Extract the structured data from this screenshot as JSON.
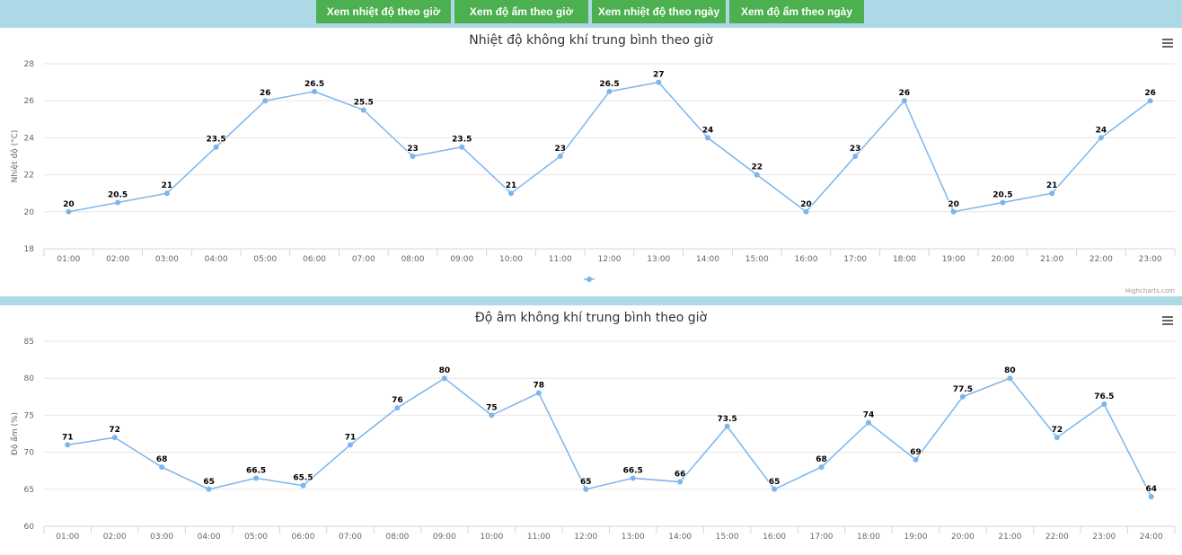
{
  "tabs": [
    {
      "label": "Xem nhiệt độ theo giờ"
    },
    {
      "label": "Xem độ ẩm theo giờ"
    },
    {
      "label": "Xem nhiệt độ theo ngày"
    },
    {
      "label": "Xem độ ẩm theo ngày"
    }
  ],
  "colors": {
    "accent": "#4caf50",
    "line": "#7cb5ec",
    "background": "#add8e6"
  },
  "credits": "Highcharts.com",
  "chart_data": [
    {
      "type": "line",
      "title": "Nhiệt độ không khí trung bình theo giờ",
      "ylabel": "Nhiệt độ (°C)",
      "xlabel": "",
      "ylim": [
        18,
        28
      ],
      "yticks": [
        "18",
        "20",
        "22",
        "24",
        "26",
        "28"
      ],
      "categories": [
        "01:00",
        "02:00",
        "03:00",
        "04:00",
        "05:00",
        "06:00",
        "07:00",
        "08:00",
        "09:00",
        "10:00",
        "11:00",
        "12:00",
        "13:00",
        "14:00",
        "15:00",
        "16:00",
        "17:00",
        "18:00",
        "19:00",
        "20:00",
        "21:00",
        "22:00",
        "23:00"
      ],
      "values": [
        20,
        20.5,
        21,
        23.5,
        26,
        26.5,
        25.5,
        23,
        23.5,
        21,
        23,
        26.5,
        27,
        24,
        22,
        20,
        23,
        26,
        20,
        20.5,
        21,
        24,
        26
      ],
      "legend": "bottom-center",
      "grid": true
    },
    {
      "type": "line",
      "title": "Độ âm không khí trung bình theo giờ",
      "ylabel": "Độ ẩm (%)",
      "xlabel": "",
      "ylim": [
        60,
        85
      ],
      "yticks": [
        "60",
        "65",
        "70",
        "75",
        "80",
        "85"
      ],
      "categories": [
        "01:00",
        "02:00",
        "03:00",
        "04:00",
        "05:00",
        "06:00",
        "07:00",
        "08:00",
        "09:00",
        "10:00",
        "11:00",
        "12:00",
        "13:00",
        "14:00",
        "15:00",
        "16:00",
        "17:00",
        "18:00",
        "19:00",
        "20:00",
        "21:00",
        "22:00",
        "23:00",
        "24:00"
      ],
      "values": [
        71,
        72,
        68,
        65,
        66.5,
        65.5,
        71,
        76,
        80,
        75,
        78,
        65,
        66.5,
        66,
        73.5,
        65,
        68,
        74,
        69,
        77.5,
        80,
        72,
        76.5,
        64
      ],
      "grid": true
    }
  ]
}
